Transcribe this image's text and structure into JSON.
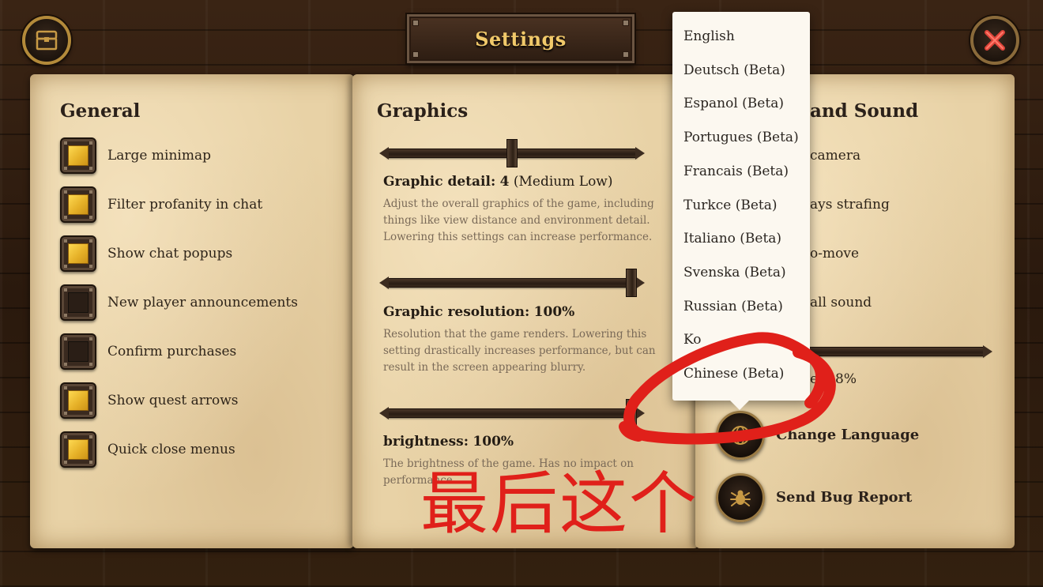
{
  "header": {
    "title": "Settings"
  },
  "general": {
    "heading": "General",
    "options": [
      {
        "label": "Large minimap",
        "checked": true
      },
      {
        "label": "Filter profanity in chat",
        "checked": true
      },
      {
        "label": "Show chat popups",
        "checked": true
      },
      {
        "label": "New player announcements",
        "checked": false
      },
      {
        "label": "Confirm purchases",
        "checked": false
      },
      {
        "label": "Show quest arrows",
        "checked": true
      },
      {
        "label": "Quick close menus",
        "checked": true
      }
    ]
  },
  "graphics": {
    "heading": "Graphics",
    "detail": {
      "label": "Graphic detail:",
      "value": "4",
      "level": "(Medium Low)",
      "position": 0.5,
      "description": "Adjust the overall graphics of the game, including things like view distance and environment detail. Lowering this settings can increase performance."
    },
    "resolution": {
      "label": "Graphic resolution:",
      "value": "100%",
      "position": 1.0,
      "description": "Resolution that the game renders. Lowering this setting drastically increases performance, but can result in the screen appearing blurry."
    },
    "brightness": {
      "label": "brightness:",
      "value": "100%",
      "position": 1.0,
      "description": "The brightness of the game. Has no impact on performance."
    }
  },
  "sound": {
    "heading_visible": "and Sound",
    "options_visible": [
      "camera",
      "ays strafing",
      "o-move",
      "all sound"
    ],
    "volume_visible": "e: 18%",
    "change_language": "Change Language",
    "send_bug_report": "Send Bug Report"
  },
  "language_menu": {
    "items": [
      "English",
      "Deutsch (Beta)",
      "Espanol (Beta)",
      "Portugues (Beta)",
      "Francais (Beta)",
      "Turkce (Beta)",
      "Italiano (Beta)",
      "Svenska (Beta)",
      "Russian (Beta)",
      "Ko",
      "Chinese (Beta)"
    ]
  },
  "annotation": {
    "text": "最后这个",
    "color": "#e0201a"
  }
}
